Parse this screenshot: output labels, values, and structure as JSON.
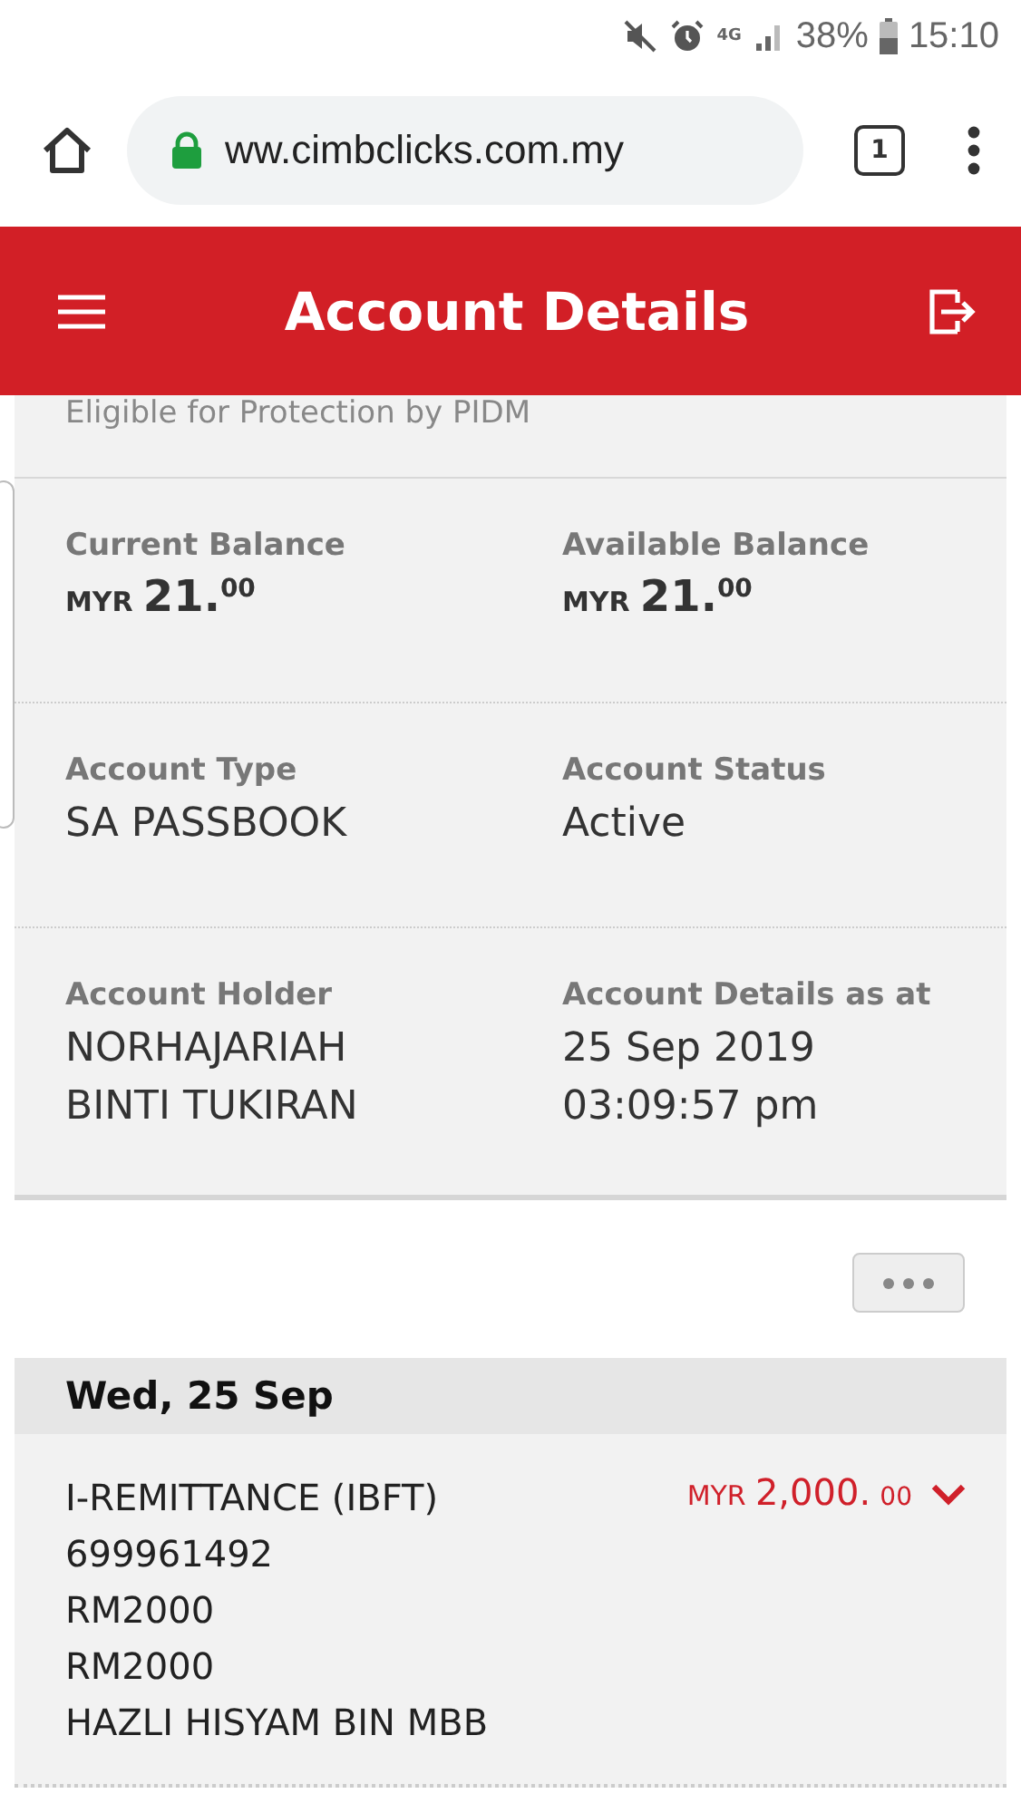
{
  "status_bar": {
    "battery": "38%",
    "time": "15:10",
    "network": "4G"
  },
  "browser": {
    "url": "ww.cimbclicks.com.my",
    "tab_count": "1"
  },
  "header": {
    "title": "Account Details"
  },
  "account": {
    "note": "Eligible for Protection by PIDM",
    "balances": [
      {
        "label": "Current Balance",
        "currency": "MYR",
        "whole": "21.",
        "cents": "00"
      },
      {
        "label": "Available Balance",
        "currency": "MYR",
        "whole": "21.",
        "cents": "00"
      }
    ],
    "fields": [
      {
        "label": "Account Type",
        "lines": [
          "SA PASSBOOK"
        ]
      },
      {
        "label": "Account Status",
        "lines": [
          "Active"
        ]
      },
      {
        "label": "Account Holder",
        "lines": [
          "NORHAJARIAH",
          "BINTI TUKIRAN"
        ]
      },
      {
        "label": "Account Details as at",
        "lines": [
          "25 Sep 2019",
          "03:09:57 pm"
        ]
      }
    ]
  },
  "transactions": [
    {
      "date": "Wed, 25 Sep",
      "items": [
        {
          "lines": [
            "I-REMITTANCE (IBFT)",
            "699961492",
            "RM2000",
            "RM2000",
            "HAZLI HISYAM BIN MBB"
          ],
          "currency": "MYR",
          "whole": "2,000.",
          "cents": "00",
          "expanded": false
        }
      ]
    }
  ]
}
